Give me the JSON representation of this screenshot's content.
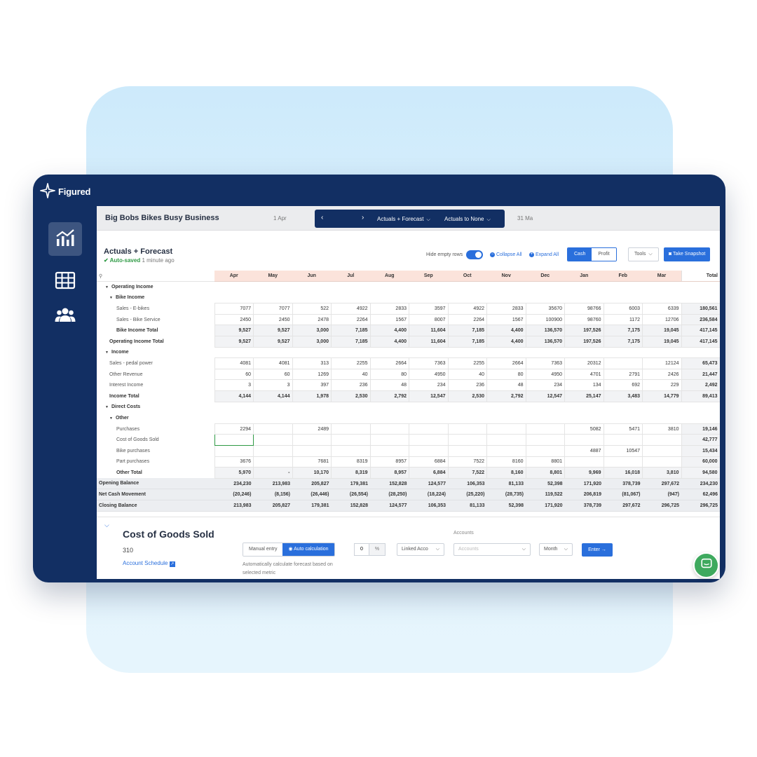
{
  "app": {
    "brand": "Figured",
    "business_name": "Big Bobs Bikes Busy Business"
  },
  "period": {
    "start_date": "1 Apr",
    "end_date": "31 Ma",
    "mode": "Actuals + Forecast",
    "compare": "Actuals to None"
  },
  "sheet": {
    "title": "Actuals + Forecast",
    "autosave_status": "Auto-saved",
    "autosave_time": "1 minute ago",
    "hide_empty_rows": "Hide empty rows",
    "collapse_all": "Collapse All",
    "expand_all": "Expand All",
    "basis": [
      "Cash",
      "Profit"
    ],
    "basis_selected": "Cash",
    "tools": "Tools",
    "snapshot": "Take Snapshot"
  },
  "table": {
    "columns": [
      "Apr",
      "May",
      "Jun",
      "Jul",
      "Aug",
      "Sep",
      "Oct",
      "Nov",
      "Dec",
      "Jan",
      "Feb",
      "Mar"
    ],
    "total_header": "Total",
    "rows": [
      {
        "label": "Operating Income",
        "kind": "section",
        "indent": 1
      },
      {
        "label": "Bike Income",
        "kind": "section",
        "indent": 2
      },
      {
        "label": "Sales - E-bikes",
        "kind": "data",
        "indent": 3,
        "values": [
          "7077",
          "7077",
          "522",
          "4922",
          "2833",
          "3597",
          "4922",
          "2833",
          "35670",
          "98766",
          "6003",
          "6339"
        ],
        "total": "180,561"
      },
      {
        "label": "Sales - Bike Service",
        "kind": "data",
        "indent": 3,
        "values": [
          "2450",
          "2450",
          "2478",
          "2264",
          "1567",
          "8007",
          "2264",
          "1567",
          "100900",
          "98760",
          "1172",
          "12706"
        ],
        "total": "236,584"
      },
      {
        "label": "Bike Income Total",
        "kind": "total",
        "indent": 3,
        "values": [
          "9,527",
          "9,527",
          "3,000",
          "7,185",
          "4,400",
          "11,604",
          "7,185",
          "4,400",
          "136,570",
          "197,526",
          "7,175",
          "19,045"
        ],
        "total": "417,145"
      },
      {
        "label": "Operating Income Total",
        "kind": "total",
        "indent": 2,
        "values": [
          "9,527",
          "9,527",
          "3,000",
          "7,185",
          "4,400",
          "11,604",
          "7,185",
          "4,400",
          "136,570",
          "197,526",
          "7,175",
          "19,045"
        ],
        "total": "417,145"
      },
      {
        "label": "Income",
        "kind": "section",
        "indent": 1
      },
      {
        "label": "Sales - pedal power",
        "kind": "data",
        "indent": 2,
        "values": [
          "4081",
          "4081",
          "313",
          "2255",
          "2664",
          "7363",
          "2255",
          "2664",
          "7363",
          "20312",
          "",
          "12124"
        ],
        "total": "65,473"
      },
      {
        "label": "Other Revenue",
        "kind": "data",
        "indent": 2,
        "values": [
          "60",
          "60",
          "1269",
          "40",
          "80",
          "4950",
          "40",
          "80",
          "4950",
          "4701",
          "2791",
          "2426"
        ],
        "total": "21,447"
      },
      {
        "label": "Interest Income",
        "kind": "data",
        "indent": 2,
        "values": [
          "3",
          "3",
          "397",
          "236",
          "48",
          "234",
          "236",
          "48",
          "234",
          "134",
          "692",
          "229"
        ],
        "total": "2,492"
      },
      {
        "label": "Income Total",
        "kind": "total",
        "indent": 2,
        "values": [
          "4,144",
          "4,144",
          "1,978",
          "2,530",
          "2,792",
          "12,547",
          "2,530",
          "2,792",
          "12,547",
          "25,147",
          "3,483",
          "14,779"
        ],
        "total": "89,413"
      },
      {
        "label": "Direct Costs",
        "kind": "section",
        "indent": 1
      },
      {
        "label": "Other",
        "kind": "section",
        "indent": 2
      },
      {
        "label": "Purchases",
        "kind": "data",
        "indent": 3,
        "values": [
          "2294",
          "",
          "2489",
          "",
          "",
          "",
          "",
          "",
          "",
          "5082",
          "5471",
          "3810"
        ],
        "total": "19,146"
      },
      {
        "label": "Cost of Goods Sold",
        "kind": "data",
        "indent": 3,
        "values": [
          "",
          "",
          "",
          "",
          "",
          "",
          "",
          "",
          "",
          "",
          "",
          ""
        ],
        "total": "42,777",
        "selected": 0
      },
      {
        "label": "Bike purchases",
        "kind": "data",
        "indent": 3,
        "values": [
          "",
          "",
          "",
          "",
          "",
          "",
          "",
          "",
          "",
          "4887",
          "10547",
          ""
        ],
        "total": "15,434"
      },
      {
        "label": "Part purchases",
        "kind": "data",
        "indent": 3,
        "values": [
          "3676",
          "",
          "7681",
          "8319",
          "8957",
          "6884",
          "7522",
          "8160",
          "8801",
          "",
          "",
          ""
        ],
        "total": "60,000"
      },
      {
        "label": "Other Total",
        "kind": "total",
        "indent": 3,
        "values": [
          "5,970",
          "-",
          "10,170",
          "8,319",
          "8,957",
          "6,884",
          "7,522",
          "8,160",
          "8,801",
          "9,969",
          "16,018",
          "3,810"
        ],
        "total": "94,580"
      },
      {
        "label": "Opening Balance",
        "kind": "grey",
        "indent": 0,
        "values": [
          "234,230",
          "213,983",
          "205,827",
          "179,381",
          "152,828",
          "124,577",
          "106,353",
          "81,133",
          "52,398",
          "171,920",
          "378,739",
          "297,672"
        ],
        "total": "234,230"
      },
      {
        "label": "Net Cash Movement",
        "kind": "grey",
        "indent": 0,
        "values": [
          "(20,246)",
          "(8,156)",
          "(26,446)",
          "(26,554)",
          "(28,250)",
          "(18,224)",
          "(25,220)",
          "(28,735)",
          "119,522",
          "206,819",
          "(81,067)",
          "(947)"
        ],
        "total": "62,496"
      },
      {
        "label": "Closing Balance",
        "kind": "grey",
        "indent": 0,
        "values": [
          "213,983",
          "205,827",
          "179,381",
          "152,828",
          "124,577",
          "106,353",
          "81,133",
          "52,398",
          "171,920",
          "378,739",
          "297,672",
          "296,725"
        ],
        "total": "296,725"
      }
    ]
  },
  "detail": {
    "title": "Cost of Goods Sold",
    "code": "310",
    "account_schedule": "Account Schedule",
    "manual_entry": "Manual entry",
    "auto_calculation": "Auto calculation",
    "auto_note": "Automatically calculate forecast based on selected metric",
    "percent_value": "0",
    "percent_unit": "%",
    "linked": "Linked Acco",
    "accounts_label": "Accounts",
    "accounts_placeholder": "Accounts",
    "month": "Month",
    "enter": "Enter"
  },
  "colors": {
    "navy": "#122f63",
    "accent": "#2a6fdc",
    "month_header": "#fbe3db",
    "success": "#2f9a45",
    "chat": "#3ea95e"
  },
  "icons": [
    "figured-logo-icon",
    "chart-nav-icon",
    "grid-nav-icon",
    "users-nav-icon",
    "search-icon",
    "chat-icon"
  ]
}
